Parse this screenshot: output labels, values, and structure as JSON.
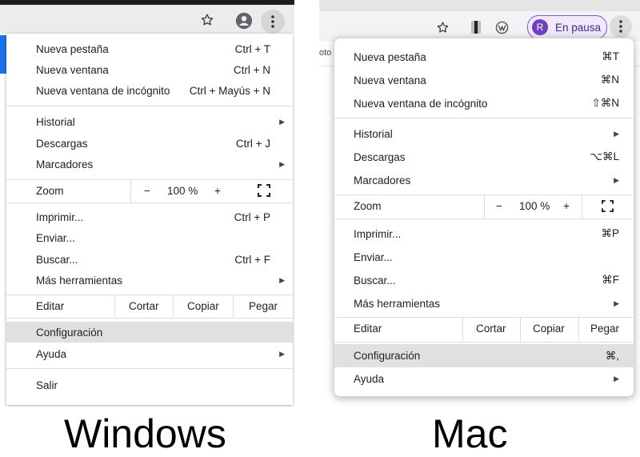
{
  "windows": {
    "caption": "Windows",
    "toolbar": {
      "star_icon": "star-icon",
      "profile_icon": "account-circle-icon",
      "menu_icon": "three-dots-icon"
    },
    "menu": {
      "new_tab": {
        "label": "Nueva pestaña",
        "shortcut": "Ctrl + T"
      },
      "new_window": {
        "label": "Nueva ventana",
        "shortcut": "Ctrl + N"
      },
      "incognito": {
        "label": "Nueva ventana de incógnito",
        "shortcut": "Ctrl + Mayús + N"
      },
      "history": {
        "label": "Historial"
      },
      "downloads": {
        "label": "Descargas",
        "shortcut": "Ctrl + J"
      },
      "bookmarks": {
        "label": "Marcadores"
      },
      "zoom": {
        "label": "Zoom",
        "minus": "−",
        "value": "100 %",
        "plus": "+"
      },
      "print": {
        "label": "Imprimir...",
        "shortcut": "Ctrl + P"
      },
      "send": {
        "label": "Enviar..."
      },
      "find": {
        "label": "Buscar...",
        "shortcut": "Ctrl + F"
      },
      "more_tools": {
        "label": "Más herramientas"
      },
      "edit": {
        "label": "Editar",
        "cut": "Cortar",
        "copy": "Copiar",
        "paste": "Pegar"
      },
      "settings": {
        "label": "Configuración"
      },
      "help": {
        "label": "Ayuda"
      },
      "exit": {
        "label": "Salir"
      }
    }
  },
  "mac": {
    "caption": "Mac",
    "page_fragment": "oto",
    "toolbar": {
      "star_icon": "star-icon",
      "profile_initial": "R",
      "profile_status": "En pausa",
      "menu_icon": "three-dots-icon"
    },
    "menu": {
      "new_tab": {
        "label": "Nueva pestaña",
        "shortcut": "⌘T"
      },
      "new_window": {
        "label": "Nueva ventana",
        "shortcut": "⌘N"
      },
      "incognito": {
        "label": "Nueva ventana de incógnito",
        "shortcut": "⇧⌘N"
      },
      "history": {
        "label": "Historial"
      },
      "downloads": {
        "label": "Descargas",
        "shortcut": "⌥⌘L"
      },
      "bookmarks": {
        "label": "Marcadores"
      },
      "zoom": {
        "label": "Zoom",
        "minus": "−",
        "value": "100 %",
        "plus": "+"
      },
      "print": {
        "label": "Imprimir...",
        "shortcut": "⌘P"
      },
      "send": {
        "label": "Enviar..."
      },
      "find": {
        "label": "Buscar...",
        "shortcut": "⌘F"
      },
      "more_tools": {
        "label": "Más herramientas"
      },
      "edit": {
        "label": "Editar",
        "cut": "Cortar",
        "copy": "Copiar",
        "paste": "Pegar"
      },
      "settings": {
        "label": "Configuración",
        "shortcut": "⌘,"
      },
      "help": {
        "label": "Ayuda"
      }
    }
  },
  "colors": {
    "highlight": "#e0e0e0",
    "profile_accent": "#6e3fbf",
    "windows_blue": "#1a73e8"
  }
}
